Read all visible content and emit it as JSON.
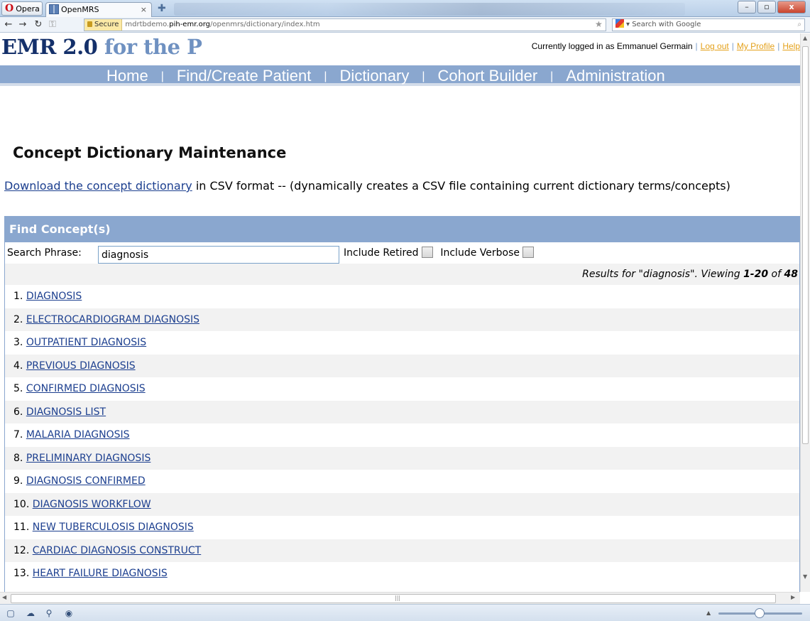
{
  "browser": {
    "app_button": "Opera",
    "tab_title": "OpenMRS",
    "tab_close": "×",
    "secure_label": "Secure",
    "url_prefix": "mdrtbdemo.",
    "url_host": "pih-emr.org",
    "url_path": "/openmrs/dictionary/index.htm",
    "search_placeholder": "Search with Google"
  },
  "header": {
    "logo_main": "EMR 2.0",
    "logo_tail": " for the P",
    "logged_in_text": "Currently logged in as Emmanuel Germain",
    "separator": "|",
    "logout": "Log out",
    "my_profile": "My Profile",
    "help": "Help"
  },
  "nav": {
    "home": "Home",
    "find_create_patient": "Find/Create Patient",
    "dictionary": "Dictionary",
    "cohort_builder": "Cohort Builder",
    "administration": "Administration",
    "separator": "|"
  },
  "main": {
    "title": "Concept Dictionary Maintenance",
    "download_link": "Download the concept dictionary",
    "download_suffix": " in CSV format -- (dynamically creates a CSV file containing current dictionary terms/concepts)"
  },
  "find": {
    "header": "Find Concept(s)",
    "search_label": "Search Phrase:",
    "search_value": "diagnosis",
    "include_retired": "Include Retired",
    "include_verbose": "Include Verbose",
    "results_prefix": "Results for \"diagnosis\".  Viewing ",
    "results_range": "1-20",
    "results_of": " of ",
    "results_total": "48",
    "results": [
      {
        "num": "1.",
        "name": "DIAGNOSIS"
      },
      {
        "num": "2.",
        "name": "ELECTROCARDIOGRAM DIAGNOSIS"
      },
      {
        "num": "3.",
        "name": "OUTPATIENT DIAGNOSIS"
      },
      {
        "num": "4.",
        "name": "PREVIOUS DIAGNOSIS"
      },
      {
        "num": "5.",
        "name": "CONFIRMED DIAGNOSIS"
      },
      {
        "num": "6.",
        "name": "DIAGNOSIS LIST"
      },
      {
        "num": "7.",
        "name": "MALARIA DIAGNOSIS"
      },
      {
        "num": "8.",
        "name": "PRELIMINARY DIAGNOSIS"
      },
      {
        "num": "9.",
        "name": "DIAGNOSIS CONFIRMED"
      },
      {
        "num": "10.",
        "name": "DIAGNOSIS WORKFLOW"
      },
      {
        "num": "11.",
        "name": "NEW TUBERCULOSIS DIAGNOSIS"
      },
      {
        "num": "12.",
        "name": "CARDIAC DIAGNOSIS CONSTRUCT"
      },
      {
        "num": "13.",
        "name": "HEART FAILURE DIAGNOSIS"
      }
    ]
  }
}
